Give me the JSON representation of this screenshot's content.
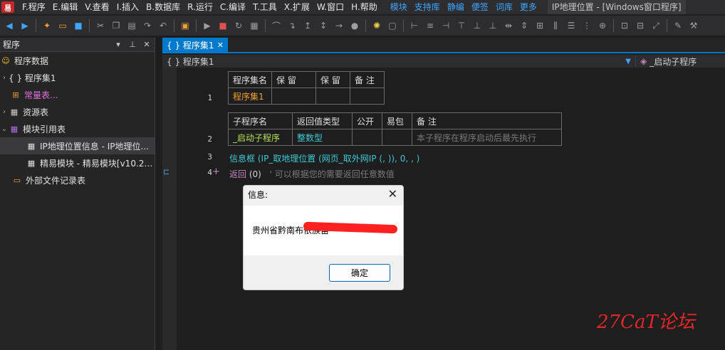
{
  "menu": {
    "items": [
      "F.程序",
      "E.编辑",
      "V.查看",
      "I.插入",
      "B.数据库",
      "R.运行",
      "C.编译",
      "T.工具",
      "X.扩展",
      "W.窗口",
      "H.帮助"
    ],
    "links": [
      "模块",
      "支持库",
      "静编",
      "便签",
      "词库",
      "更多"
    ],
    "window_title": "IP地理位置 - [Windows窗口程序]"
  },
  "left_panel": {
    "title": "程序",
    "tree": [
      {
        "label": "程序数据",
        "icon": "smiley-icon",
        "color": "#f5c518"
      },
      {
        "label": "{ } 程序集1",
        "icon": "",
        "color": "#e0e0e0"
      },
      {
        "label": "常量表...",
        "icon": "constant-table-icon",
        "color": "#e070e0"
      },
      {
        "label": "资源表",
        "icon": "resource-table-icon",
        "color": "#e0e0e0"
      },
      {
        "label": "模块引用表",
        "icon": "module-table-icon",
        "color": "#e0e0e0"
      },
      {
        "label": "IP地理位置信息 - IP地理位...",
        "icon": "module-icon",
        "color": "#e0e0e0"
      },
      {
        "label": "精易模块 - 精易模块[v10.2....",
        "icon": "module-icon",
        "color": "#e0e0e0"
      },
      {
        "label": "外部文件记录表",
        "icon": "file-record-icon",
        "color": "#e0e0e0"
      }
    ]
  },
  "editor": {
    "tab_label": "{ } 程序集1",
    "nav_left": "{ } 程序集1",
    "nav_right": "_启动子程序",
    "lines": [
      "1",
      "2",
      "3",
      "4"
    ],
    "table1": {
      "headers": [
        "程序集名",
        "保 留",
        "保 留",
        "备 注"
      ],
      "row": [
        "程序集1",
        "",
        "",
        ""
      ]
    },
    "table2": {
      "headers": [
        "子程序名",
        "返回值类型",
        "公开",
        "易包",
        "备 注"
      ],
      "row": [
        "_启动子程序",
        "整数型",
        "",
        "",
        "本子程序在程序启动后最先执行"
      ]
    },
    "line3": {
      "func": "信息框",
      "args": "(IP_取地理位置 (网页_取外网IP (, )), 0, , )"
    },
    "line4": {
      "kw": "返回",
      "args": "(0)",
      "comment": "' 可以根据您的需要返回任意数值"
    }
  },
  "dialog": {
    "title": "信息:",
    "message": "贵州省黔南布依族苗",
    "ok_label": "确定"
  },
  "watermark": "27CaT论坛"
}
